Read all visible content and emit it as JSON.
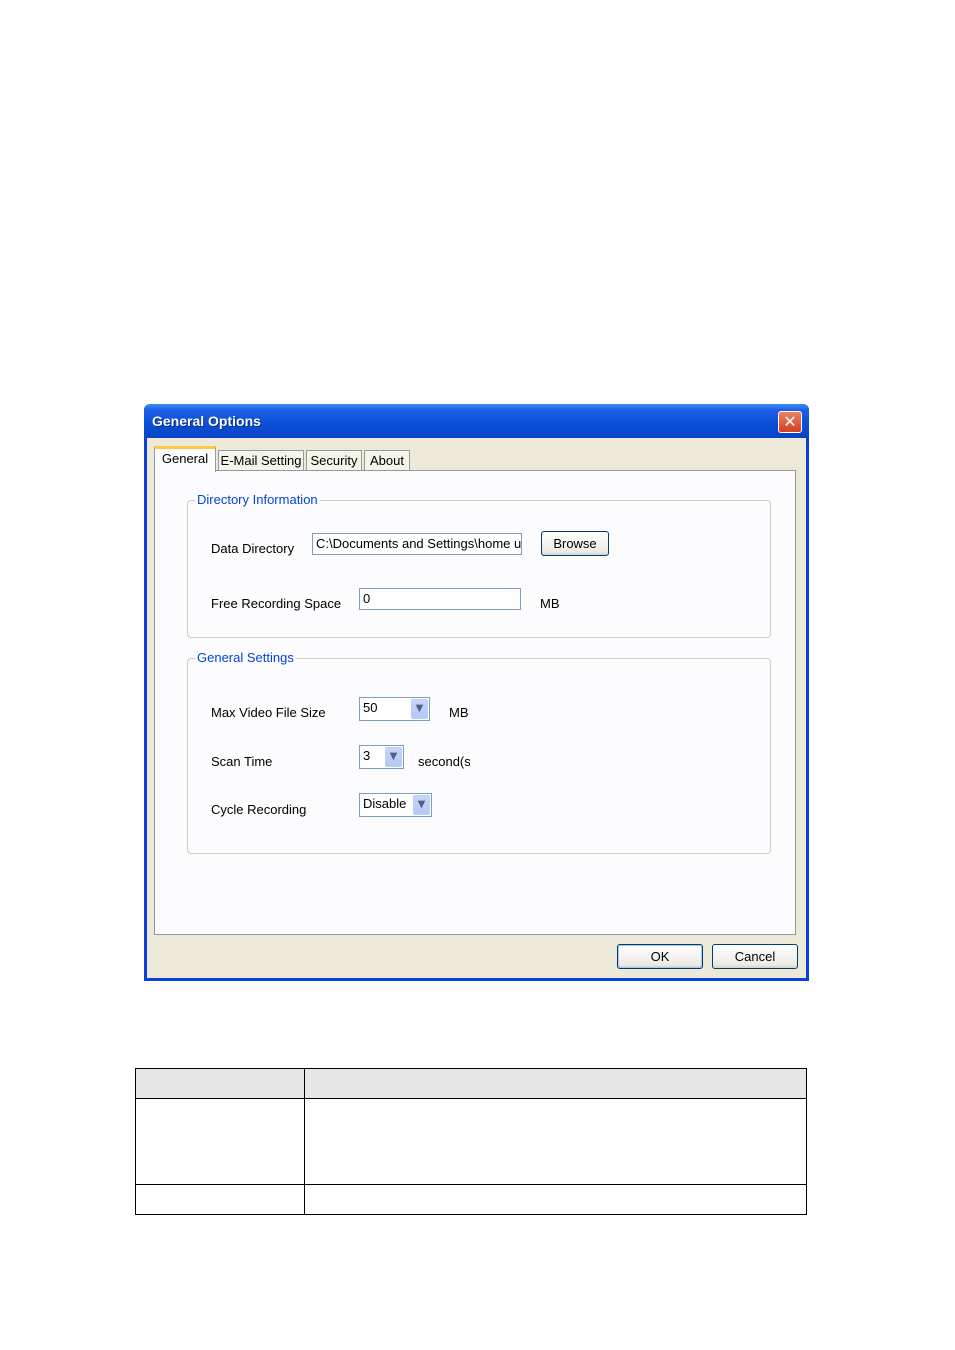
{
  "window": {
    "title": "General Options",
    "close_glyph": "✕"
  },
  "tabs": [
    {
      "label": "General",
      "active": true
    },
    {
      "label": "E-Mail Setting",
      "active": false
    },
    {
      "label": "Security",
      "active": false
    },
    {
      "label": "About",
      "active": false
    }
  ],
  "directory_info": {
    "legend": "Directory Information",
    "data_directory_label": "Data Directory",
    "data_directory_value": "C:\\Documents and Settings\\home u",
    "browse_label": "Browse",
    "free_space_label": "Free Recording Space",
    "free_space_value": "0",
    "free_space_unit": "MB"
  },
  "general_settings": {
    "legend": "General Settings",
    "max_video_label": "Max Video File Size",
    "max_video_value": "50",
    "max_video_unit": "MB",
    "scan_time_label": "Scan Time",
    "scan_time_value": "3",
    "scan_time_unit": "second(s)",
    "cycle_label": "Cycle Recording",
    "cycle_value": "Disable"
  },
  "footer": {
    "ok_label": "OK",
    "cancel_label": "Cancel"
  },
  "icons": {
    "dropdown": "chevron-down-icon",
    "close": "close-icon"
  },
  "colors": {
    "titlebar": "#0a4fd6",
    "legend_text": "#0046d5",
    "active_tab_accent": "#ffc83c",
    "dialog_bg": "#ece9d8"
  }
}
